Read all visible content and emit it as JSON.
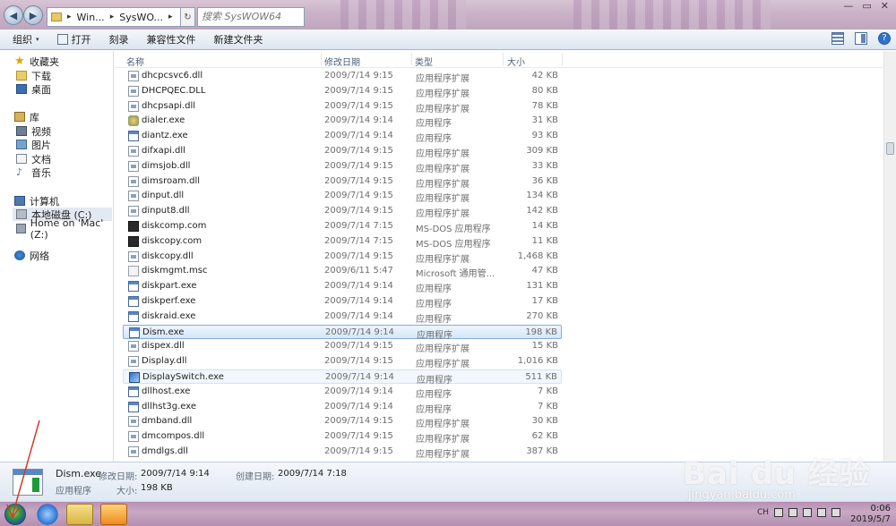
{
  "titlebar": {
    "path": [
      "Win...",
      "SysWO..."
    ],
    "search_placeholder": "搜索 SysWOW64",
    "window_controls": [
      "—",
      "▭",
      "✕"
    ]
  },
  "toolbar": {
    "organize": "组织",
    "open": "打开",
    "burn": "刻录",
    "compat_files": "兼容性文件",
    "new_folder": "新建文件夹"
  },
  "nav": {
    "favorites": "收藏夹",
    "downloads": "下载",
    "desktop": "桌面",
    "libraries": "库",
    "videos": "视频",
    "pictures": "图片",
    "documents": "文档",
    "music": "音乐",
    "computer": "计算机",
    "local_disk": "本地磁盘 (C:)",
    "mac_home": "Home on 'Mac' (Z:)",
    "network": "网络"
  },
  "columns": {
    "name": "名称",
    "date": "修改日期",
    "type": "类型",
    "size": "大小"
  },
  "files": [
    {
      "name": "dhcpcsvc6.dll",
      "date": "2009/7/14 9:15",
      "type": "应用程序扩展",
      "size": "42 KB",
      "icon": "dll"
    },
    {
      "name": "DHCPQEC.DLL",
      "date": "2009/7/14 9:15",
      "type": "应用程序扩展",
      "size": "80 KB",
      "icon": "dll"
    },
    {
      "name": "dhcpsapi.dll",
      "date": "2009/7/14 9:15",
      "type": "应用程序扩展",
      "size": "78 KB",
      "icon": "dll"
    },
    {
      "name": "dialer.exe",
      "date": "2009/7/14 9:14",
      "type": "应用程序",
      "size": "31 KB",
      "icon": "dialer"
    },
    {
      "name": "diantz.exe",
      "date": "2009/7/14 9:14",
      "type": "应用程序",
      "size": "93 KB",
      "icon": "exe"
    },
    {
      "name": "difxapi.dll",
      "date": "2009/7/14 9:15",
      "type": "应用程序扩展",
      "size": "309 KB",
      "icon": "dll"
    },
    {
      "name": "dimsjob.dll",
      "date": "2009/7/14 9:15",
      "type": "应用程序扩展",
      "size": "33 KB",
      "icon": "dll"
    },
    {
      "name": "dimsroam.dll",
      "date": "2009/7/14 9:15",
      "type": "应用程序扩展",
      "size": "36 KB",
      "icon": "dll"
    },
    {
      "name": "dinput.dll",
      "date": "2009/7/14 9:15",
      "type": "应用程序扩展",
      "size": "134 KB",
      "icon": "dll"
    },
    {
      "name": "dinput8.dll",
      "date": "2009/7/14 9:15",
      "type": "应用程序扩展",
      "size": "142 KB",
      "icon": "dll"
    },
    {
      "name": "diskcomp.com",
      "date": "2009/7/14 7:15",
      "type": "MS-DOS 应用程序",
      "size": "14 KB",
      "icon": "com"
    },
    {
      "name": "diskcopy.com",
      "date": "2009/7/14 7:15",
      "type": "MS-DOS 应用程序",
      "size": "11 KB",
      "icon": "com"
    },
    {
      "name": "diskcopy.dll",
      "date": "2009/7/14 9:15",
      "type": "应用程序扩展",
      "size": "1,468 KB",
      "icon": "dll"
    },
    {
      "name": "diskmgmt.msc",
      "date": "2009/6/11 5:47",
      "type": "Microsoft 通用管...",
      "size": "47 KB",
      "icon": "msc"
    },
    {
      "name": "diskpart.exe",
      "date": "2009/7/14 9:14",
      "type": "应用程序",
      "size": "131 KB",
      "icon": "exe"
    },
    {
      "name": "diskperf.exe",
      "date": "2009/7/14 9:14",
      "type": "应用程序",
      "size": "17 KB",
      "icon": "exe"
    },
    {
      "name": "diskraid.exe",
      "date": "2009/7/14 9:14",
      "type": "应用程序",
      "size": "270 KB",
      "icon": "exe"
    },
    {
      "name": "Dism.exe",
      "date": "2009/7/14 9:14",
      "type": "应用程序",
      "size": "198 KB",
      "icon": "exe",
      "state": "selected"
    },
    {
      "name": "dispex.dll",
      "date": "2009/7/14 9:15",
      "type": "应用程序扩展",
      "size": "15 KB",
      "icon": "dll"
    },
    {
      "name": "Display.dll",
      "date": "2009/7/14 9:15",
      "type": "应用程序扩展",
      "size": "1,016 KB",
      "icon": "dll"
    },
    {
      "name": "DisplaySwitch.exe",
      "date": "2009/7/14 9:14",
      "type": "应用程序",
      "size": "511 KB",
      "icon": "display",
      "state": "hover"
    },
    {
      "name": "dllhost.exe",
      "date": "2009/7/14 9:14",
      "type": "应用程序",
      "size": "7 KB",
      "icon": "exe"
    },
    {
      "name": "dllhst3g.exe",
      "date": "2009/7/14 9:14",
      "type": "应用程序",
      "size": "7 KB",
      "icon": "exe"
    },
    {
      "name": "dmband.dll",
      "date": "2009/7/14 9:15",
      "type": "应用程序扩展",
      "size": "30 KB",
      "icon": "dll"
    },
    {
      "name": "dmcompos.dll",
      "date": "2009/7/14 9:15",
      "type": "应用程序扩展",
      "size": "62 KB",
      "icon": "dll"
    },
    {
      "name": "dmdlgs.dll",
      "date": "2009/7/14 9:15",
      "type": "应用程序扩展",
      "size": "387 KB",
      "icon": "dll"
    }
  ],
  "details": {
    "name": "Dism.exe",
    "modified_label": "修改日期:",
    "modified_value": "2009/7/14 9:14",
    "created_label": "创建日期:",
    "created_value": "2009/7/14 7:18",
    "type": "应用程序",
    "size_label": "大小:",
    "size_value": "198 KB"
  },
  "taskbar": {
    "tray_lang": "CH",
    "time": "0:06",
    "date": "2019/5/7"
  },
  "watermark": {
    "brand": "Bai du 经验",
    "url": "jingyan.baidu.com"
  },
  "colors": {
    "selection": "#d5e6fa",
    "taskbar": "#b78fb4",
    "annotation_arrow": "#d23a2a"
  }
}
